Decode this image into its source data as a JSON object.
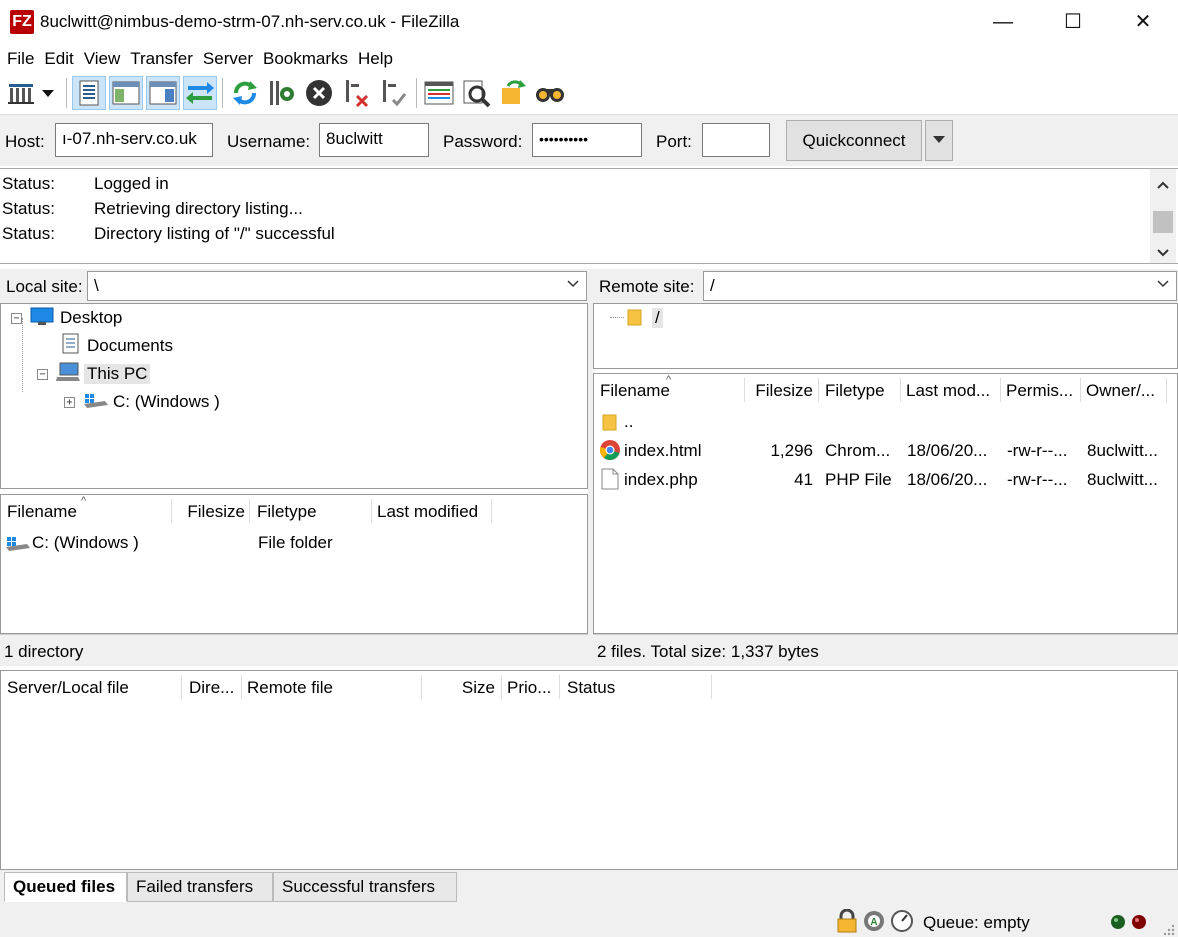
{
  "window": {
    "title": "8uclwitt@nimbus-demo-strm-07.nh-serv.co.uk - FileZilla",
    "app_icon_text": "FZ"
  },
  "menu": [
    "File",
    "Edit",
    "View",
    "Transfer",
    "Server",
    "Bookmarks",
    "Help"
  ],
  "toolbar": {
    "icons": [
      "site-manager-icon",
      "dropdown-arrow-icon",
      "toggle-message-log-icon",
      "toggle-local-tree-icon",
      "toggle-remote-tree-icon",
      "toggle-transfer-queue-icon",
      "refresh-icon",
      "process-queue-icon",
      "cancel-icon",
      "disconnect-icon",
      "reconnect-icon",
      "directory-comparison-icon",
      "filename-filter-icon",
      "synchronized-browsing-icon",
      "search-icon"
    ]
  },
  "quickconnect": {
    "host_label": "Host:",
    "host_value": "ı-07.nh-serv.co.uk",
    "username_label": "Username:",
    "username_value": "8uclwitt",
    "password_label": "Password:",
    "password_value": "••••••••••",
    "port_label": "Port:",
    "port_value": "",
    "button_label": "Quickconnect"
  },
  "log": [
    {
      "key": "Status:",
      "message": "Logged in"
    },
    {
      "key": "Status:",
      "message": "Retrieving directory listing..."
    },
    {
      "key": "Status:",
      "message": "Directory listing of \"/\" successful"
    }
  ],
  "local": {
    "site_label": "Local site:",
    "site_path": "\\",
    "tree": [
      {
        "label": "Desktop",
        "expander": "−"
      },
      {
        "label": "Documents",
        "expander": ""
      },
      {
        "label": "This PC",
        "expander": "−"
      },
      {
        "label": "C: (Windows )",
        "expander": "+"
      }
    ],
    "columns": [
      "Filename",
      "Filesize",
      "Filetype",
      "Last modified"
    ],
    "files": [
      {
        "name": "C: (Windows )",
        "size": "",
        "type": "File folder",
        "modified": ""
      }
    ],
    "status": "1 directory"
  },
  "remote": {
    "site_label": "Remote site:",
    "site_path": "/",
    "tree": [
      {
        "label": "/"
      }
    ],
    "columns": [
      "Filename",
      "Filesize",
      "Filetype",
      "Last mod...",
      "Permis...",
      "Owner/..."
    ],
    "files": [
      {
        "name": "..",
        "size": "",
        "type": "",
        "modified": "",
        "perms": "",
        "owner": ""
      },
      {
        "name": "index.html",
        "size": "1,296",
        "type": "Chrom...",
        "modified": "18/06/20...",
        "perms": "-rw-r--...",
        "owner": "8uclwitt..."
      },
      {
        "name": "index.php",
        "size": "41",
        "type": "PHP File",
        "modified": "18/06/20...",
        "perms": "-rw-r--...",
        "owner": "8uclwitt..."
      }
    ],
    "status": "2 files. Total size: 1,337 bytes"
  },
  "queue": {
    "columns": [
      "Server/Local file",
      "Dire...",
      "Remote file",
      "Size",
      "Prio...",
      "Status"
    ],
    "tabs": [
      "Queued files",
      "Failed transfers",
      "Successful transfers"
    ],
    "status": "Queue: empty"
  }
}
